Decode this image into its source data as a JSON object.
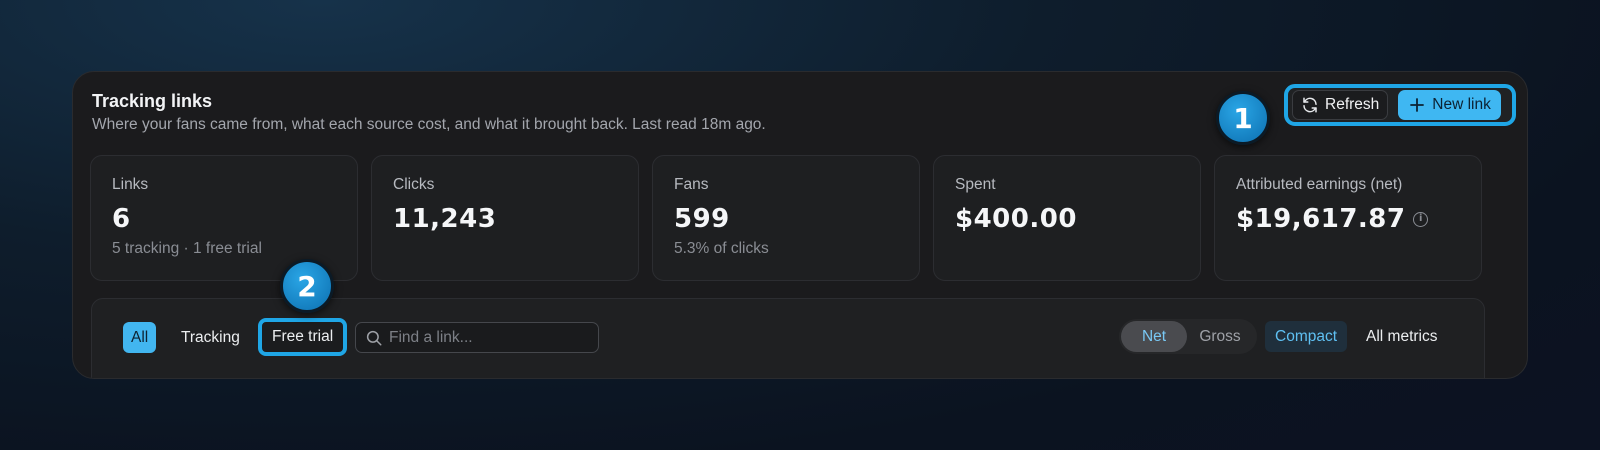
{
  "header": {
    "title": "Tracking links",
    "subtitle": "Where your fans came from, what each source cost, and what it brought back. Last read 18m ago."
  },
  "actions": {
    "refresh_label": "Refresh",
    "new_link_label": "New link",
    "refresh_icon": "refresh-icon",
    "plus_icon": "plus-icon"
  },
  "markers": [
    "1",
    "2"
  ],
  "stats": [
    {
      "label": "Links",
      "value": "6",
      "sub": "5 tracking · 1 free trial"
    },
    {
      "label": "Clicks",
      "value": "11,243",
      "sub": ""
    },
    {
      "label": "Fans",
      "value": "599",
      "sub": "5.3% of clicks"
    },
    {
      "label": "Spent",
      "value": "$400.00",
      "sub": ""
    },
    {
      "label": "Attributed earnings (net)",
      "value": "$19,617.87",
      "sub": "",
      "info_icon": "info-icon"
    }
  ],
  "filters": {
    "tabs": [
      "All",
      "Tracking",
      "Free trial"
    ],
    "active_tab": "All",
    "search_placeholder": "Find a link...",
    "search_value": "",
    "earnings_mode": [
      "Net",
      "Gross"
    ],
    "active_mode": "Net",
    "views": [
      "Compact",
      "All metrics"
    ],
    "active_view": "Compact"
  },
  "colors": {
    "accent": "#42b6f0",
    "highlight": "#1fa6e6",
    "panel": "#1b1b1d"
  }
}
